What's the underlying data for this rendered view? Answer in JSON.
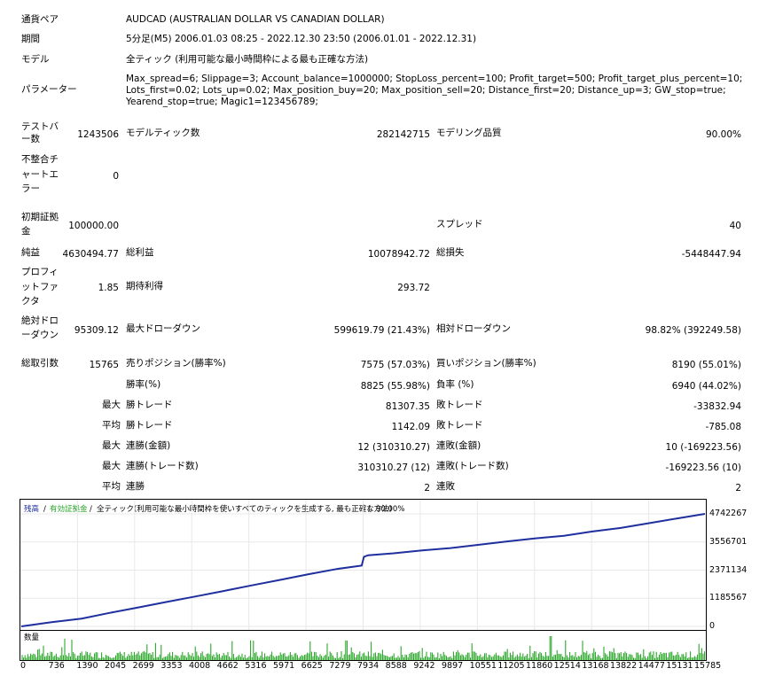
{
  "info": {
    "pair_label": "通貨ペア",
    "pair_value": "AUDCAD (AUSTRALIAN DOLLAR VS CANADIAN DOLLAR)",
    "period_label": "期間",
    "period_value": "5分足(M5) 2006.01.03 08:25 - 2022.12.30 23:50 (2006.01.01 - 2022.12.31)",
    "model_label": "モデル",
    "model_value": "全ティック (利用可能な最小時間枠による最も正確な方法)",
    "params_label": "パラメーター",
    "params_lines": [
      "Max_spread=6; Slippage=3; Account_balance=1000000; StopLoss_percent=100; Profit_target=500; Profit_target_plus_percent=10;",
      "Lots_first=0.02; Lots_up=0.02; Max_position_buy=20; Max_position_sell=20; Distance_first=20; Distance_up=3; GW_stop=true;",
      "Yearend_stop=true; Magic1=123456789;"
    ]
  },
  "stats": {
    "test_bars_label": [
      "テストバ",
      "ー数"
    ],
    "test_bars_value": "1243506",
    "model_ticks_label": "モデルティック数",
    "model_ticks_value": "282142715",
    "model_quality_label": "モデリング品質",
    "model_quality_value": "90.00%",
    "mismatch_label": [
      "不整合チ",
      "ャートエ",
      "ラー"
    ],
    "mismatch_value": "0",
    "initial_deposit_label": [
      "初期証拠",
      "金"
    ],
    "initial_deposit_value": "100000.00",
    "spread_label": "スプレッド",
    "spread_value": "40",
    "net_profit_label": "純益",
    "net_profit_value": "4630494.77",
    "gross_profit_label": "総利益",
    "gross_profit_value": "10078942.72",
    "gross_loss_label": "総損失",
    "gross_loss_value": "-5448447.94",
    "profit_factor_label": [
      "プロフィ",
      "ットファ",
      "クタ"
    ],
    "profit_factor_value": "1.85",
    "expected_payoff_label": "期待利得",
    "expected_payoff_value": "293.72",
    "abs_dd_label": [
      "絶対ドロ",
      "ーダウン"
    ],
    "abs_dd_value": "95309.12",
    "max_dd_label": "最大ドローダウン",
    "max_dd_value": "599619.79 (21.43%)",
    "rel_dd_label": "相対ドローダウン",
    "rel_dd_value": "98.82% (392249.58)",
    "total_trades_label": "総取引数",
    "total_trades_value": "15765",
    "short_pos_label": "売りポジション(勝率%)",
    "short_pos_value": "7575 (57.03%)",
    "long_pos_label": "買いポジション(勝率%)",
    "long_pos_value": "8190 (55.01%)",
    "win_rate_label": "勝率(%)",
    "win_rate_value": "8825 (55.98%)",
    "loss_rate_label": "負率 (%)",
    "loss_rate_value": "6940 (44.02%)",
    "max_label": "最大",
    "avg_label": "平均",
    "largest_win_label": "勝トレード",
    "largest_win_value": "81307.35",
    "largest_loss_label": "敗トレード",
    "largest_loss_value": "-33832.94",
    "avg_win_label": "勝トレード",
    "avg_win_value": "1142.09",
    "avg_loss_label": "敗トレード",
    "avg_loss_value": "-785.08",
    "max_consec_wins_label": "連勝(金額)",
    "max_consec_wins_value": "12 (310310.27)",
    "max_consec_losses_label": "連敗(金額)",
    "max_consec_losses_value": "10 (-169223.56)",
    "max_consec_profit_label": "連勝(トレード数)",
    "max_consec_profit_value": "310310.27 (12)",
    "max_consec_loss_label": "連敗(トレード数)",
    "max_consec_loss_value": "-169223.56 (10)",
    "avg_consec_wins_label": "連勝",
    "avg_consec_wins_value": "2",
    "avg_consec_losses_label": "連敗",
    "avg_consec_losses_value": "2"
  },
  "chart_data": [
    {
      "type": "line",
      "legend": {
        "balance": "残高",
        "sep1": " / ",
        "equity": "有効証拠金",
        "sep2": " / ",
        "model": "全ティック(利用可能な最小時間枠を使いすべてのティックを生成する, 最も正確な方法)",
        "sep3": " / ",
        "quality": "90.00%"
      },
      "colors": {
        "balance": "#1f2f9e",
        "equity": "#2aa52a"
      },
      "y_ticks": [
        "4742267",
        "3556701",
        "2371134",
        "1185567",
        "0"
      ],
      "y_tick_values": [
        4742267,
        3556701,
        2371134,
        1185567,
        0
      ],
      "ylim": [
        0,
        4742267
      ],
      "xlim": [
        0,
        15765
      ],
      "series": [
        {
          "name": "残高",
          "x": [
            0,
            700,
            1390,
            2045,
            2699,
            3353,
            4008,
            4662,
            5316,
            5971,
            6625,
            7279,
            7850,
            7900,
            8000,
            8588,
            9242,
            9897,
            10551,
            11205,
            11860,
            12514,
            13168,
            13822,
            14477,
            15131,
            15765
          ],
          "y": [
            0,
            180000,
            330000,
            570000,
            800000,
            1030000,
            1260000,
            1490000,
            1730000,
            1960000,
            2200000,
            2420000,
            2560000,
            2930000,
            3000000,
            3080000,
            3200000,
            3300000,
            3440000,
            3580000,
            3710000,
            3820000,
            4000000,
            4150000,
            4350000,
            4550000,
            4742267
          ]
        }
      ]
    },
    {
      "type": "bar",
      "label": "数量",
      "x_ticks": [
        "0",
        "736",
        "1390",
        "2045",
        "2699",
        "3353",
        "4008",
        "4662",
        "5316",
        "5971",
        "6625",
        "7279",
        "7934",
        "8588",
        "9242",
        "9897",
        "10551",
        "11205",
        "11860",
        "12514",
        "13168",
        "13822",
        "14477",
        "15131",
        "15785"
      ],
      "xlim": [
        0,
        15785
      ],
      "color": "#19a019"
    }
  ]
}
